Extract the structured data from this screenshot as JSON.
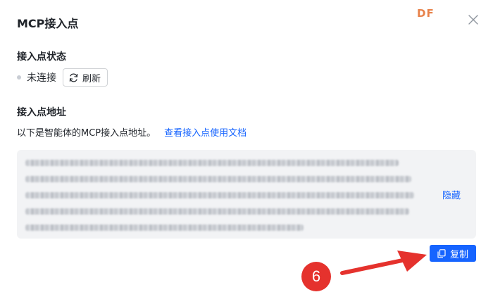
{
  "dialog": {
    "title": "MCP接入点",
    "brand_mark": "DF",
    "close_icon": "close-icon"
  },
  "status_section": {
    "label": "接入点状态",
    "status_text": "未连接",
    "status_color": "#c9cdd4",
    "refresh_label": "刷新",
    "refresh_icon": "refresh-icon"
  },
  "address_section": {
    "label": "接入点地址",
    "description": "以下是智能体的MCP接入点地址。",
    "doc_link": "查看接入点使用文档",
    "hide_label": "隐藏",
    "copy_label": "复制",
    "copy_icon": "copy-icon"
  },
  "annotation": {
    "step_number": "6",
    "color": "#e5322d"
  },
  "colors": {
    "accent": "#1664ff",
    "brand": "#e8824a"
  }
}
